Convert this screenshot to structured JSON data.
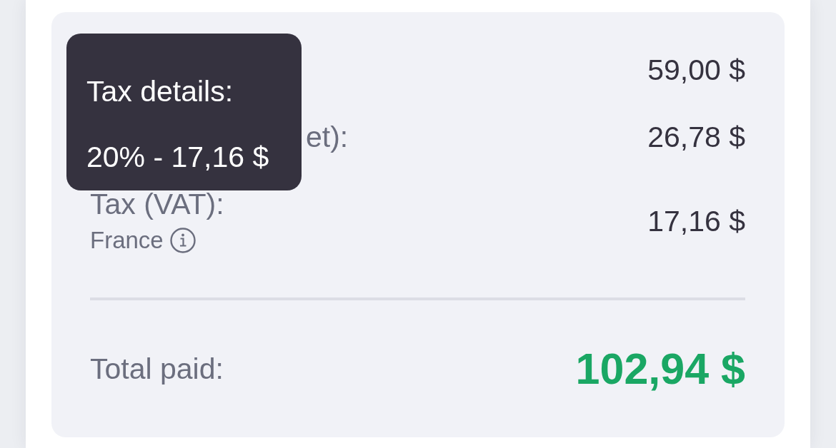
{
  "summary": {
    "rows": [
      {
        "value": "59,00 $"
      },
      {
        "label": "et):",
        "label_covered": true,
        "value": "26,78 $"
      },
      {
        "label": "Tax (VAT):",
        "label_covered": false,
        "note": "France",
        "value": "17,16 $"
      }
    ],
    "total": {
      "label": "Total paid:",
      "value": "102,94 $"
    }
  },
  "tooltip": {
    "lines": [
      "Tax details:",
      "20% - 17,16 $"
    ]
  }
}
